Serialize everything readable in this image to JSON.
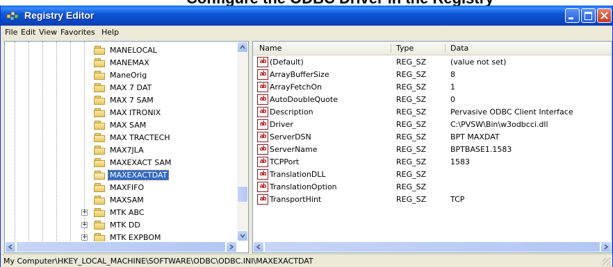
{
  "banner": {
    "text": "Configure the ODBC Driver in the Registry"
  },
  "window": {
    "title": "Registry Editor"
  },
  "menu": [
    "File",
    "Edit",
    "View",
    "Favorites",
    "Help"
  ],
  "tree": {
    "items": [
      {
        "label": "MANELOCAL",
        "expandable": false,
        "selected": false
      },
      {
        "label": "MANEMAX",
        "expandable": false,
        "selected": false
      },
      {
        "label": "ManeOrig",
        "expandable": false,
        "selected": false
      },
      {
        "label": "MAX 7 DAT",
        "expandable": false,
        "selected": false
      },
      {
        "label": "MAX 7 SAM",
        "expandable": false,
        "selected": false
      },
      {
        "label": "MAX ITRONIX",
        "expandable": false,
        "selected": false
      },
      {
        "label": "MAX SAM",
        "expandable": false,
        "selected": false
      },
      {
        "label": "MAX TRACTECH",
        "expandable": false,
        "selected": false
      },
      {
        "label": "MAX7JLA",
        "expandable": false,
        "selected": false
      },
      {
        "label": "MAXEXACT SAM",
        "expandable": false,
        "selected": false
      },
      {
        "label": "MAXEXACTDAT",
        "expandable": false,
        "selected": true
      },
      {
        "label": "MAXFIFO",
        "expandable": false,
        "selected": false
      },
      {
        "label": "MAXSAM",
        "expandable": false,
        "selected": false
      },
      {
        "label": "MTK ABC",
        "expandable": true,
        "selected": false
      },
      {
        "label": "MTK DD",
        "expandable": true,
        "selected": false
      },
      {
        "label": "MTK EXPBOM",
        "expandable": true,
        "selected": false
      }
    ]
  },
  "columns": {
    "name": "Name",
    "type": "Type",
    "data": "Data"
  },
  "values": [
    {
      "name": "(Default)",
      "type": "REG_SZ",
      "data": "(value not set)"
    },
    {
      "name": "ArrayBufferSize",
      "type": "REG_SZ",
      "data": "8"
    },
    {
      "name": "ArrayFetchOn",
      "type": "REG_SZ",
      "data": "1"
    },
    {
      "name": "AutoDoubleQuote",
      "type": "REG_SZ",
      "data": "0"
    },
    {
      "name": "Description",
      "type": "REG_SZ",
      "data": "Pervasive ODBC Client Interface"
    },
    {
      "name": "Driver",
      "type": "REG_SZ",
      "data": "C:\\PVSW\\Bin\\w3odbcci.dll"
    },
    {
      "name": "ServerDSN",
      "type": "REG_SZ",
      "data": "BPT MAXDAT"
    },
    {
      "name": "ServerName",
      "type": "REG_SZ",
      "data": "BPTBASE1.1583"
    },
    {
      "name": "TCPPort",
      "type": "REG_SZ",
      "data": "1583"
    },
    {
      "name": "TranslationDLL",
      "type": "REG_SZ",
      "data": ""
    },
    {
      "name": "TranslationOption",
      "type": "REG_SZ",
      "data": ""
    },
    {
      "name": "TransportHint",
      "type": "REG_SZ",
      "data": "TCP"
    }
  ],
  "value_icon": "ab",
  "status": {
    "path": "My Computer\\HKEY_LOCAL_MACHINE\\SOFTWARE\\ODBC\\ODBC.INI\\MAXEXACTDAT"
  },
  "colors": {
    "titlebar": "#0a48c4",
    "selection": "#316ac5",
    "close_button": "#c53a1e"
  }
}
